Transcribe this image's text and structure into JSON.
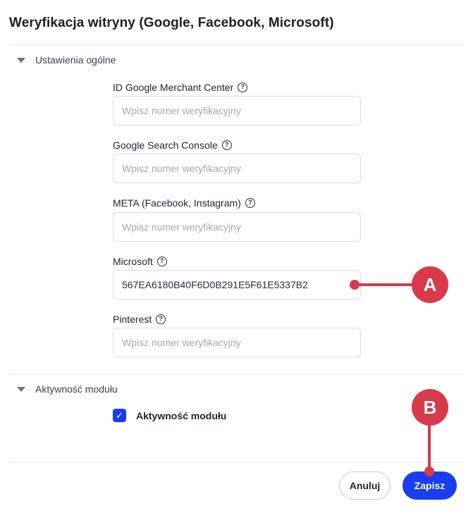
{
  "dialog": {
    "title": "Weryfikacja witryny (Google, Facebook, Microsoft)"
  },
  "sections": {
    "general": {
      "label": "Ustawienia ogólne"
    },
    "module": {
      "label": "Aktywność modułu"
    }
  },
  "fields": [
    {
      "label": "ID Google Merchant Center",
      "value": "",
      "placeholder": "Wpisz numer weryfikacyjny"
    },
    {
      "label": "Google Search Console",
      "value": "",
      "placeholder": "Wpisz numer weryfikacyjny"
    },
    {
      "label": "META (Facebook, Instagram)",
      "value": "",
      "placeholder": "Wpisz numer weryfikacyjny"
    },
    {
      "label": "Microsoft",
      "value": "567EA6180B40F6D0B291E5F61E5337B2",
      "placeholder": "Wpisz numer weryfikacyjny"
    },
    {
      "label": "Pinterest",
      "value": "",
      "placeholder": "Wpisz numer weryfikacyjny"
    }
  ],
  "help_icon_glyph": "?",
  "module_checkbox": {
    "label": "Aktywność modułu",
    "checked": true,
    "glyph": "✓"
  },
  "buttons": {
    "cancel": "Anuluj",
    "save": "Zapisz"
  },
  "annotations": {
    "a": "A",
    "b": "B"
  },
  "colors": {
    "primary": "#1a3df0",
    "annotation": "#d83a4a"
  }
}
